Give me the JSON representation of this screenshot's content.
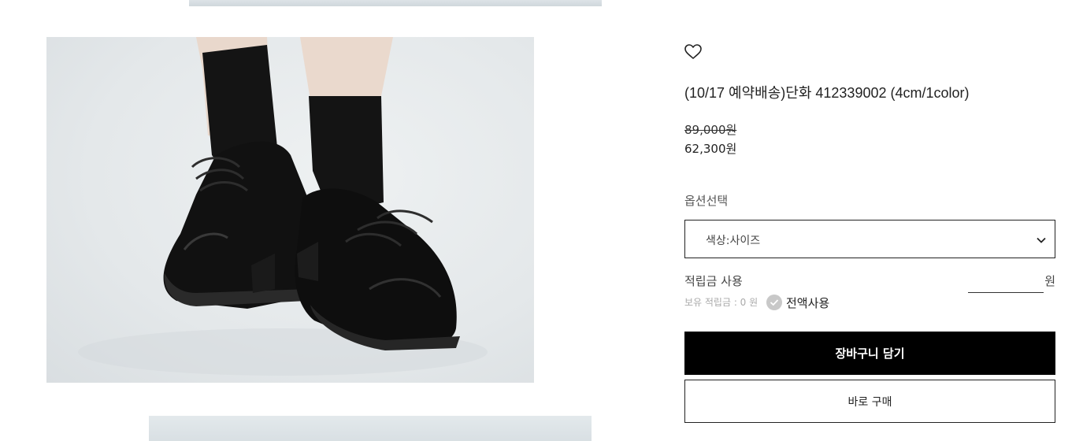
{
  "product": {
    "title": "(10/17 예약배송)단화 412339002 (4cm/1color)",
    "original_price": "89,000원",
    "sale_price": "62,300원"
  },
  "options": {
    "label": "옵션선택",
    "selected": "색상:사이즈"
  },
  "points": {
    "label": "적립금 사용",
    "unit": "원",
    "held_text": "보유 적립금 : 0 원",
    "use_all_label": "전액사용",
    "input_value": ""
  },
  "actions": {
    "cart_label": "장바구니 담기",
    "buy_label": "바로 구매"
  },
  "icons": {
    "wishlist": "heart-outline-icon",
    "select_arrow": "chevron-down-icon",
    "use_all": "check-circle-icon"
  },
  "colors": {
    "primary_button_bg": "#000000",
    "check_circle": "#c8c8c8"
  }
}
